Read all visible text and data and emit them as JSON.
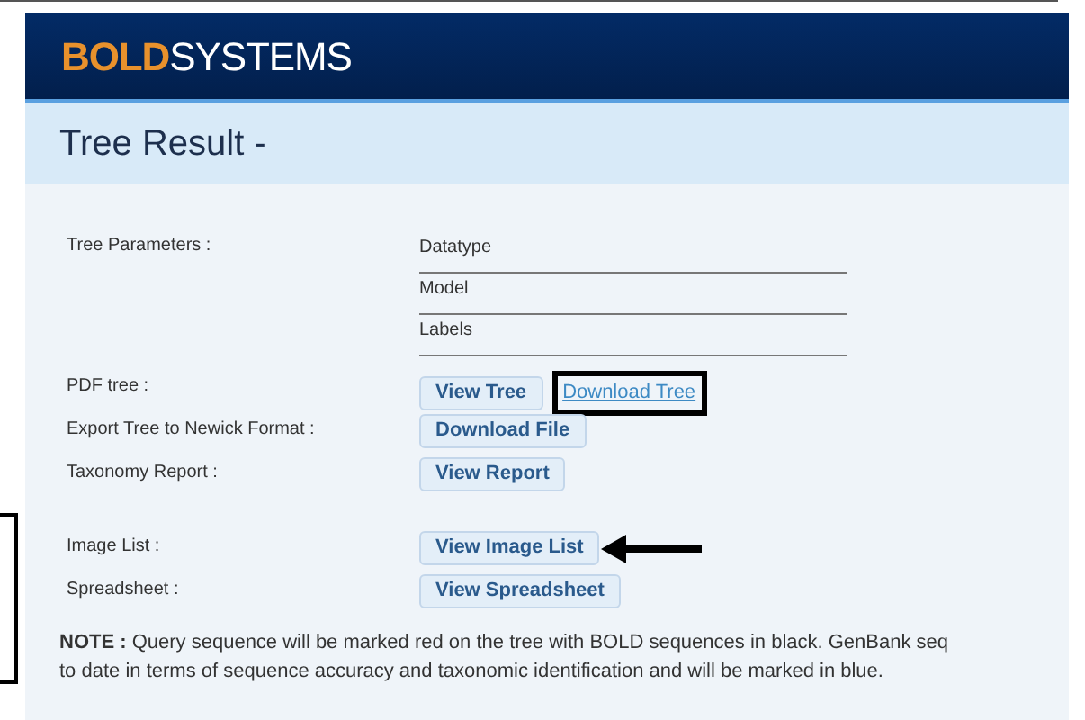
{
  "logo": {
    "bold": "BOLD",
    "rest": "SYSTEMS"
  },
  "title": "Tree Result -",
  "parameters": {
    "label": "Tree Parameters :",
    "values": [
      "Datatype",
      "Model",
      "Labels"
    ]
  },
  "rows": [
    {
      "label": "PDF tree :",
      "gap": false,
      "items": [
        {
          "kind": "button",
          "text": "View Tree",
          "outlined": false,
          "arrow": false
        },
        {
          "kind": "link",
          "text": "Download Tree",
          "outlined": true,
          "arrow": false
        }
      ]
    },
    {
      "label": "Export Tree to Newick Format :",
      "gap": false,
      "items": [
        {
          "kind": "button",
          "text": "Download File",
          "outlined": false,
          "arrow": false
        }
      ]
    },
    {
      "label": "Taxonomy Report :",
      "gap": false,
      "items": [
        {
          "kind": "button",
          "text": "View Report",
          "outlined": false,
          "arrow": false
        }
      ]
    },
    {
      "label": "Image List :",
      "gap": true,
      "items": [
        {
          "kind": "button",
          "text": "View Image List",
          "outlined": false,
          "arrow": true
        }
      ]
    },
    {
      "label": "Spreadsheet :",
      "gap": false,
      "items": [
        {
          "kind": "button",
          "text": "View Spreadsheet",
          "outlined": false,
          "arrow": false
        }
      ]
    }
  ],
  "note": [
    "**NOTE :** Query sequence will be marked red on the tree with BOLD sequences in black. GenBank seq",
    "to date in terms of sequence accuracy and taxonomic identification and will be marked in blue."
  ]
}
